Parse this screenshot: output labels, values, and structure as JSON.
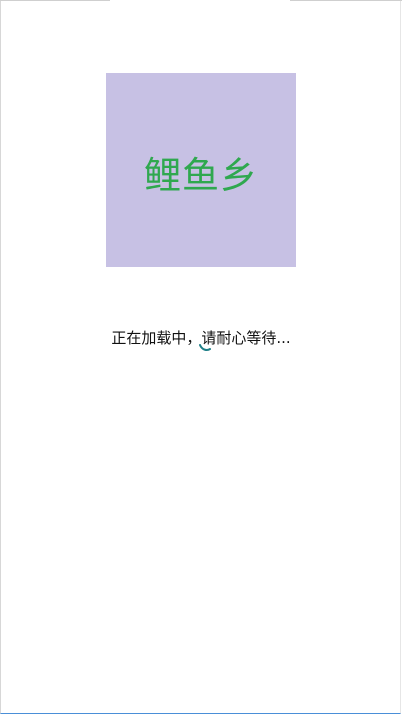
{
  "splash": {
    "logo_text": "鲤鱼乡",
    "loading_message": "正在加载中，请耐心等待..."
  },
  "colors": {
    "logo_background": "#c7c1e4",
    "logo_text": "#2fa84f",
    "spinner": "#1e7f87"
  },
  "icons": {
    "spinner": "loading-spinner-icon"
  }
}
